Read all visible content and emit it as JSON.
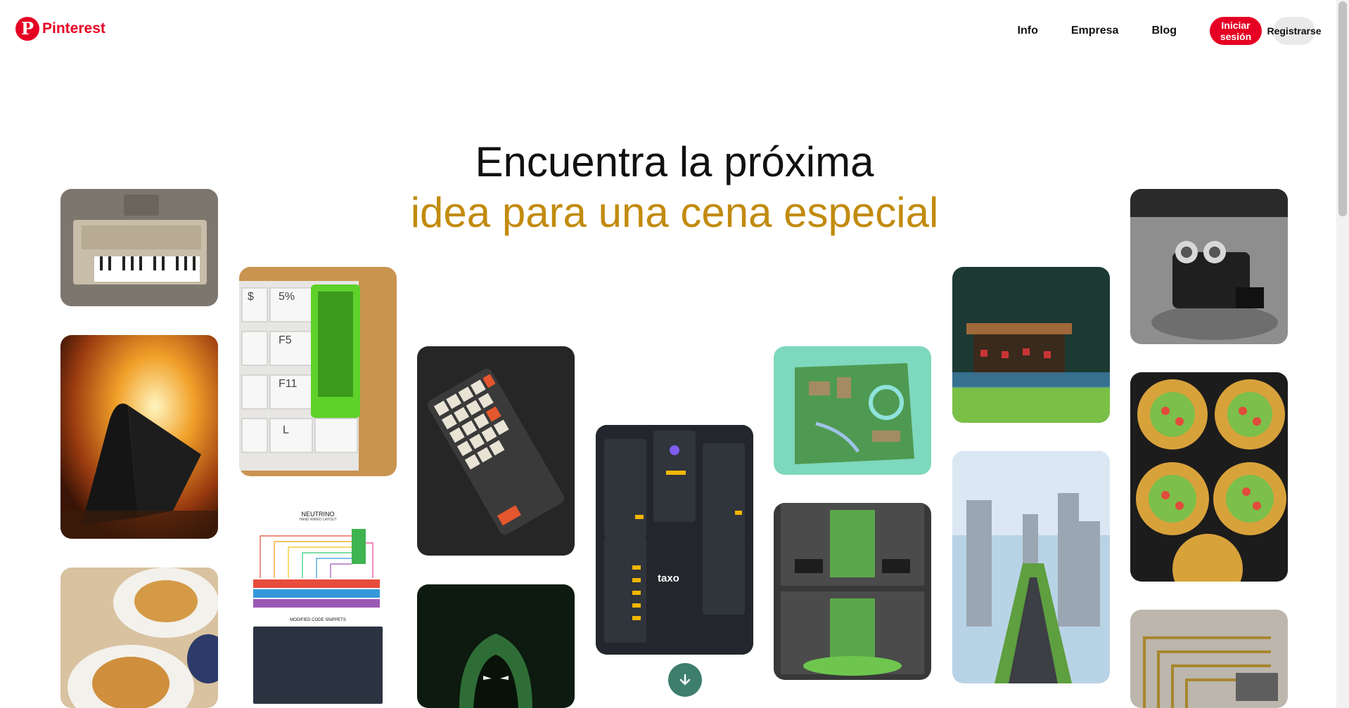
{
  "brand": {
    "name": "Pinterest",
    "logo_glyph": "P",
    "color": "#e60023"
  },
  "nav": {
    "links": [
      "Info",
      "Empresa",
      "Blog"
    ],
    "login": "Iniciar sesión",
    "register": "Registrarse"
  },
  "hero": {
    "line1": "Encuentra la próxima",
    "line2": "idea para una cena especial",
    "accent_color": "#c28b0e"
  },
  "pins": {
    "taxo_label": "taxo",
    "neutrino_title": "NEUTRINO",
    "neutrino_sub": "HAND WIRED LAYOUT",
    "neutrino_code": "MODIFIED CODE SNIPPETS"
  },
  "scroll_button_icon": "arrow-down-icon"
}
